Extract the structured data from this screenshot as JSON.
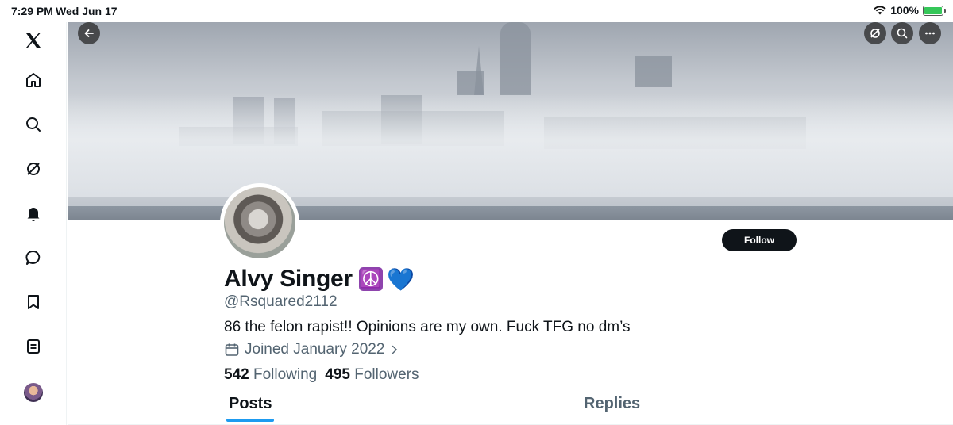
{
  "status_bar": {
    "time": "7:29 PM",
    "date": "Wed Jun 17",
    "battery": "100%"
  },
  "sidebar": {
    "items": [
      {
        "icon": "x-logo-icon"
      },
      {
        "icon": "home-icon"
      },
      {
        "icon": "search-icon"
      },
      {
        "icon": "grok-icon"
      },
      {
        "icon": "notifications-icon"
      },
      {
        "icon": "messages-icon"
      },
      {
        "icon": "bookmarks-icon"
      },
      {
        "icon": "lists-icon"
      },
      {
        "icon": "account-avatar"
      }
    ]
  },
  "header": {
    "back_icon": "back-arrow-icon",
    "actions": [
      "grok-icon",
      "search-icon",
      "more-icon"
    ]
  },
  "profile": {
    "name": "Alvy Singer",
    "name_emojis": [
      "☮️",
      "💙"
    ],
    "handle": "@Rsquared2112",
    "bio": "86 the felon rapist!! Opinions are my own. Fuck TFG no dm’s",
    "joined": "Joined January 2022",
    "following_count": "542",
    "following_label": "Following",
    "followers_count": "495",
    "followers_label": "Followers",
    "follow_label": "Follow"
  },
  "tabs": [
    {
      "label": "Posts",
      "selected": true
    },
    {
      "label": "Replies",
      "selected": false
    }
  ],
  "colors": {
    "accent": "#1d9bf0",
    "text": "#0f1419",
    "secondary": "#536471"
  }
}
